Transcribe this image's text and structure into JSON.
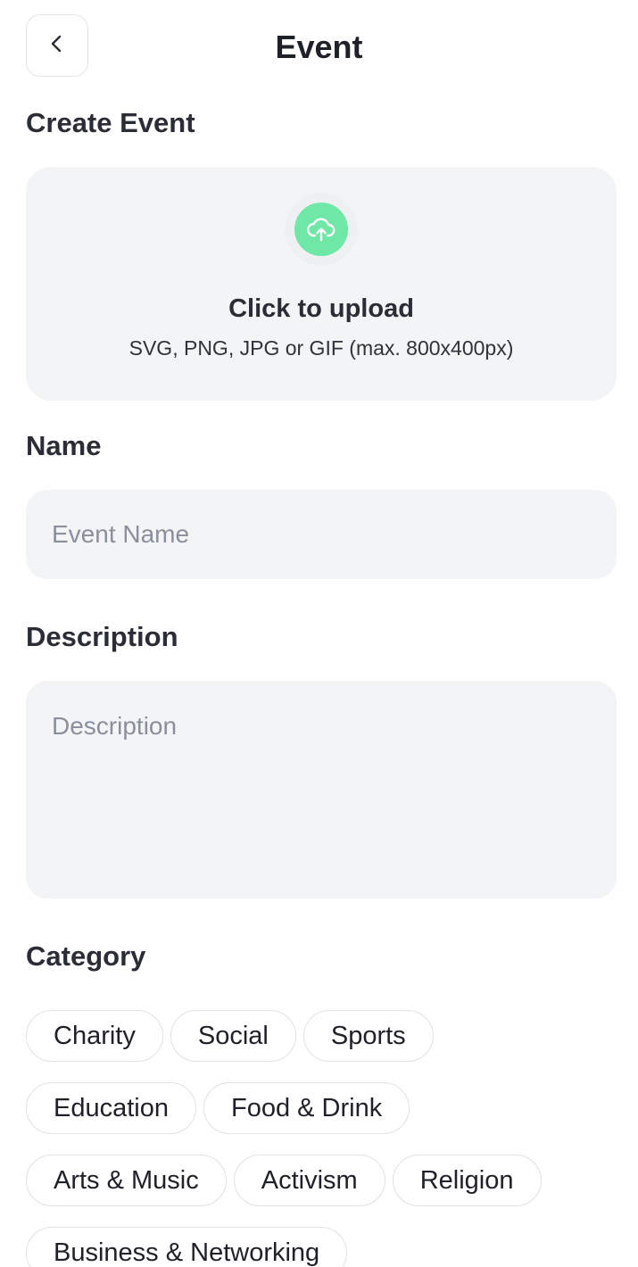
{
  "header": {
    "title": "Event",
    "back_icon": "chevron-left-icon"
  },
  "create": {
    "title": "Create Event"
  },
  "upload": {
    "icon": "cloud-upload-icon",
    "accent_color": "#6ee7a7",
    "title": "Click to upload",
    "hint": "SVG, PNG, JPG or GIF (max. 800x400px)"
  },
  "name": {
    "label": "Name",
    "placeholder": "Event Name",
    "value": ""
  },
  "description": {
    "label": "Description",
    "placeholder": "Description",
    "value": ""
  },
  "category": {
    "label": "Category",
    "chips": [
      "Charity",
      "Social",
      "Sports",
      "Education",
      "Food & Drink",
      "Arts & Music",
      "Activism",
      "Religion",
      "Business & Networking"
    ]
  }
}
